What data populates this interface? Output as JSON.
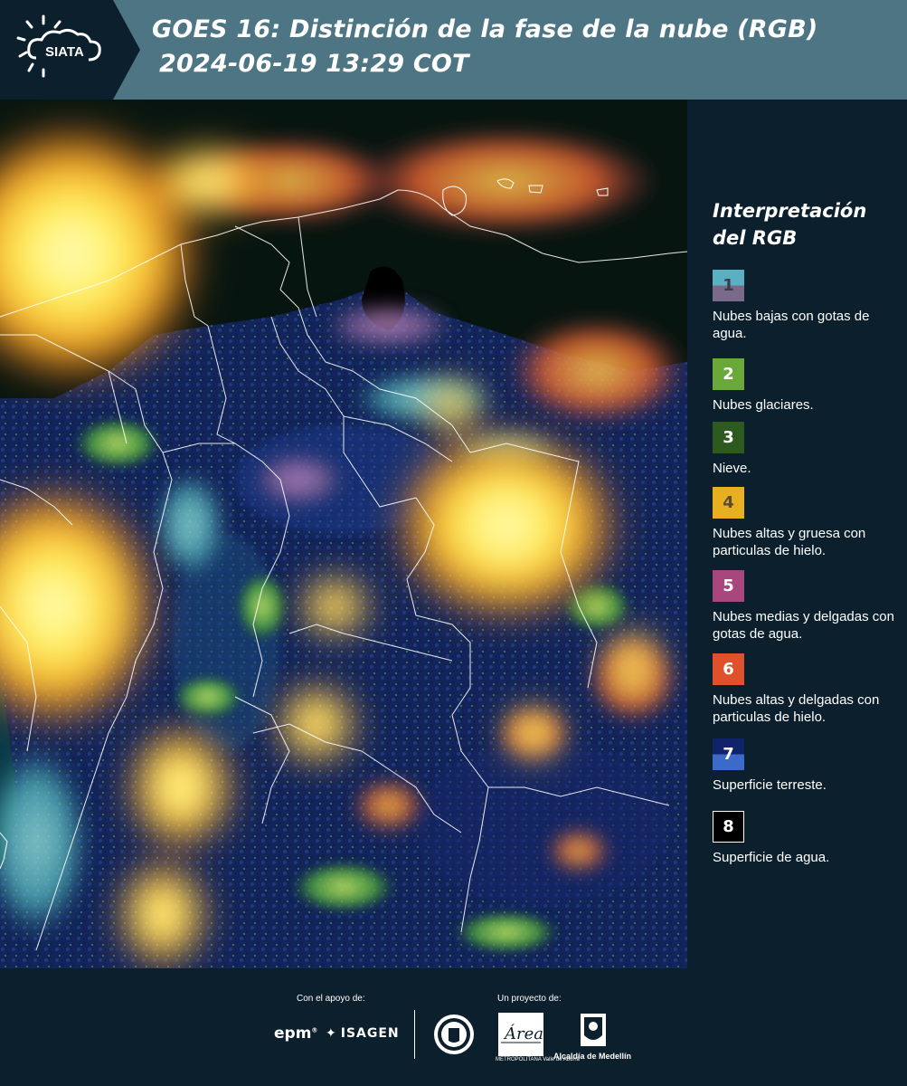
{
  "header": {
    "logo_text": "SIATA",
    "title_line1": "GOES 16: Distinción de la fase de la nube (RGB)",
    "title_line2": "2024-06-19 13:29 COT"
  },
  "legend": {
    "title_line1": "Interpretación",
    "title_line2": "del RGB",
    "items": [
      {
        "number": "1",
        "label": "Nubes bajas con gotas de agua.",
        "top_color": "#5ab0c0",
        "bottom_color": "#7a6a8a",
        "text_color": "#3a3a4a"
      },
      {
        "number": "2",
        "label": "Nubes glaciares.",
        "top_color": "#6aa83a",
        "bottom_color": "#6aa83a",
        "text_color": "#ffffff"
      },
      {
        "number": "3",
        "label": "Nieve.",
        "top_color": "#2f5a1f",
        "bottom_color": "#2f5a1f",
        "text_color": "#ffffff"
      },
      {
        "number": "4",
        "label": "Nubes altas y gruesa con particulas de hielo.",
        "top_color": "#e8b020",
        "bottom_color": "#e8b020",
        "text_color": "#5a4a30"
      },
      {
        "number": "5",
        "label": "Nubes medias y delgadas con gotas de agua.",
        "top_color": "#a8467e",
        "bottom_color": "#a8467e",
        "text_color": "#ffffff"
      },
      {
        "number": "6",
        "label": "Nubes altas y delgadas con particulas de hielo.",
        "top_color": "#e0502a",
        "bottom_color": "#e0502a",
        "text_color": "#ffffff"
      },
      {
        "number": "7",
        "label": "Superficie terreste.",
        "top_color": "#10226a",
        "bottom_color": "#3c6ac8",
        "text_color": "#ffffff"
      },
      {
        "number": "8",
        "label": "Superficie de agua.",
        "top_color": "#000000",
        "bottom_color": "#000000",
        "text_color": "#ffffff"
      }
    ]
  },
  "footer": {
    "support_label": "Con el apoyo de:",
    "project_label": "Un proyecto de:",
    "epm": "epm",
    "isagen": "ISAGEN",
    "amva_text": "METROPOLITANA Valle de Aburrá",
    "alcaldia": "Alcaldía de Medellín"
  }
}
